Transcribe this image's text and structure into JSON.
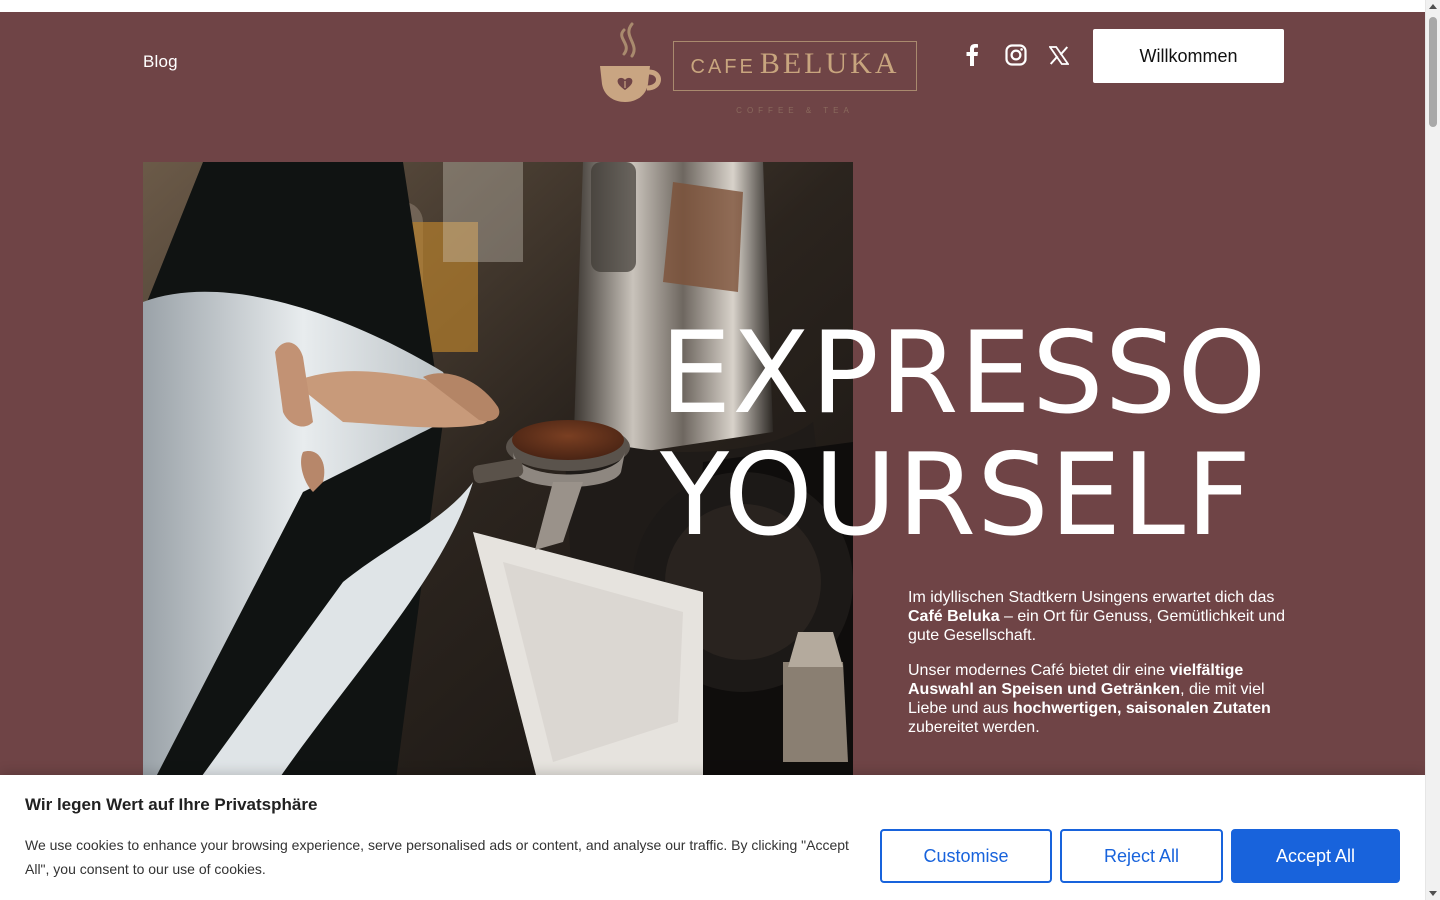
{
  "nav": {
    "blog_label": "Blog",
    "welcome_button": "Willkommen"
  },
  "logo": {
    "cafe": "CAFE",
    "beluka": "BELUKA",
    "tagline": "COFFEE & TEA"
  },
  "social": {
    "icons": [
      "facebook-icon",
      "instagram-icon",
      "x-icon"
    ]
  },
  "hero": {
    "headline_line1": "EXPRESSO",
    "headline_line2": "YOURSELF",
    "paragraph1": {
      "part1": "Im idyllischen Stadtkern Usingens erwartet dich das ",
      "bold1": "Café Beluka",
      "part2": " – ein Ort für Genuss, Gemütlichkeit und gute Gesellschaft."
    },
    "paragraph2": {
      "part1": "Unser modernes Café bietet dir eine ",
      "bold1": "vielfältige Auswahl an Speisen und Getränken",
      "part2": ", die mit viel Liebe und aus ",
      "bold2": "hochwertigen, saisonalen Zutaten",
      "part3": " zubereitet werden."
    }
  },
  "cookie": {
    "title": "Wir legen Wert auf Ihre Privatsphäre",
    "text": "We use cookies to enhance your browsing experience, serve personalised ads or content, and analyse our traffic. By clicking \"Accept All\", you consent to our use of cookies.",
    "customise_label": "Customise",
    "reject_label": "Reject All",
    "accept_label": "Accept All"
  },
  "colors": {
    "background": "#6f4446",
    "accent_blue": "#1863dc",
    "logo_gold": "#c8a57e"
  }
}
